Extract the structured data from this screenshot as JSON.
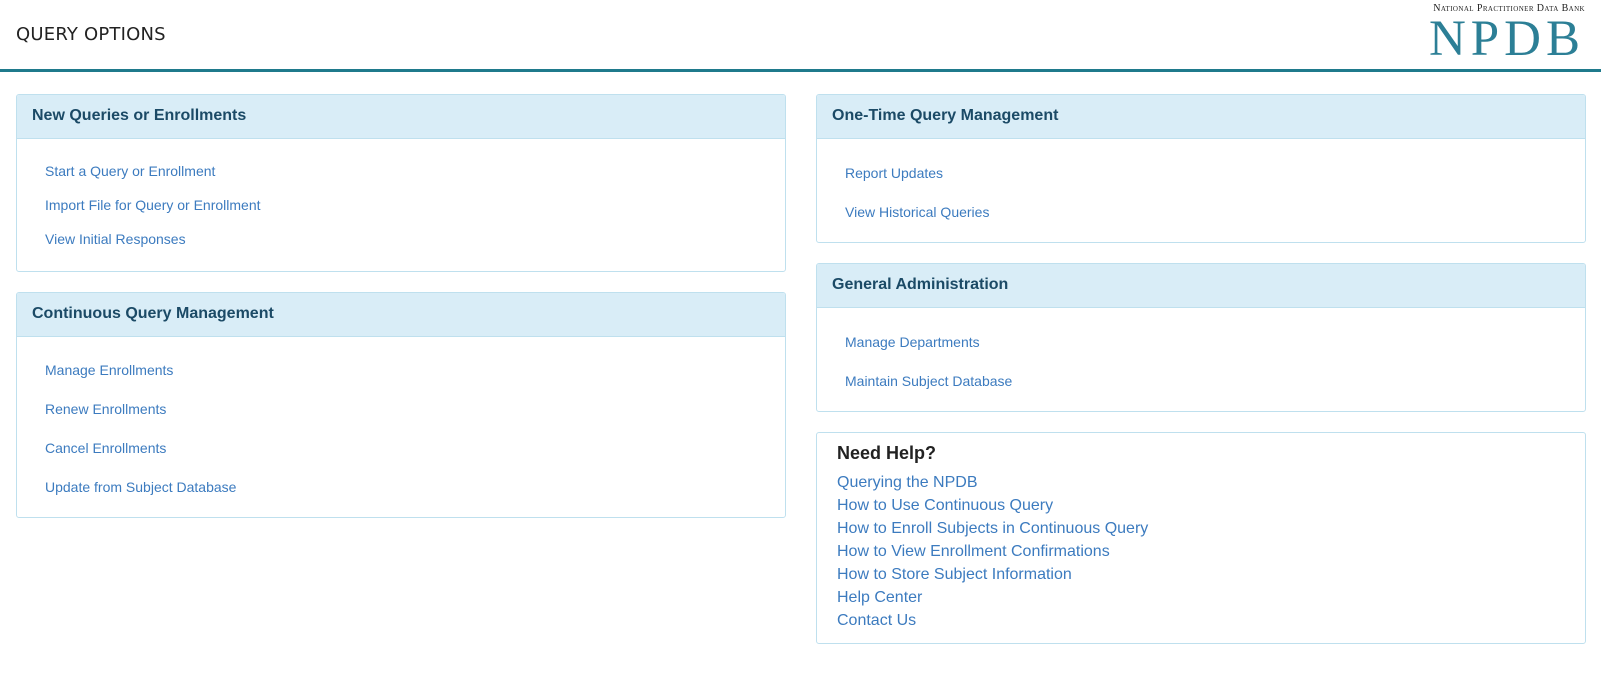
{
  "header": {
    "title": "QUERY OPTIONS",
    "logo_subtitle": "National Practitioner Data Bank",
    "logo_text": "NPDB"
  },
  "colors": {
    "accent": "#1f7a8c",
    "panel_header_bg": "#d9edf7",
    "link": "#3c7bbf",
    "panel_title": "#1b4a66"
  },
  "panels": {
    "new_queries": {
      "title": "New Queries or Enrollments",
      "links": [
        "Start a Query or Enrollment",
        "Import File for Query or Enrollment",
        "View Initial Responses"
      ]
    },
    "continuous": {
      "title": "Continuous Query Management",
      "links": [
        "Manage Enrollments",
        "Renew Enrollments",
        "Cancel Enrollments",
        "Update from Subject Database"
      ]
    },
    "one_time": {
      "title": "One-Time Query Management",
      "links": [
        "Report Updates",
        "View Historical Queries"
      ]
    },
    "general_admin": {
      "title": "General Administration",
      "links": [
        "Manage Departments",
        "Maintain Subject Database"
      ]
    }
  },
  "help": {
    "title": "Need Help?",
    "links": [
      "Querying the NPDB",
      "How to Use Continuous Query",
      "How to Enroll Subjects in Continuous Query",
      "How to View Enrollment Confirmations",
      "How to Store Subject Information",
      "Help Center",
      "Contact Us"
    ]
  }
}
